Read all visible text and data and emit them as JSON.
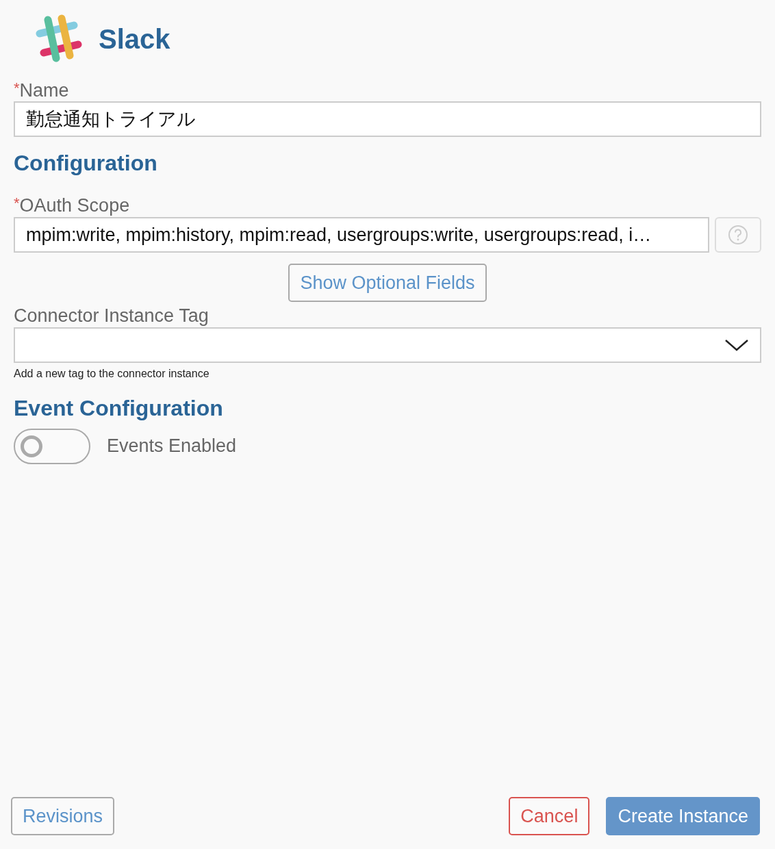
{
  "header": {
    "title": "Slack"
  },
  "name_field": {
    "required_mark": "*",
    "label": "Name",
    "value": "勤怠通知トライアル"
  },
  "configuration": {
    "heading": "Configuration",
    "oauth_scope": {
      "required_mark": "*",
      "label": "OAuth Scope",
      "value": "mpim:write, mpim:history, mpim:read, usergroups:write, usergroups:read, i…"
    },
    "optional_button": "Show Optional Fields",
    "tag_field": {
      "label": "Connector Instance Tag",
      "help": "Add a new tag to the connector instance"
    }
  },
  "event_configuration": {
    "heading": "Event Configuration",
    "toggle": {
      "label": "Events Enabled",
      "on": false
    }
  },
  "footer": {
    "buttons": [
      {
        "label": "Revisions",
        "kind": "outline"
      },
      {
        "label": "Cancel",
        "kind": "danger"
      },
      {
        "label": "Create Instance",
        "kind": "primary"
      }
    ]
  }
}
